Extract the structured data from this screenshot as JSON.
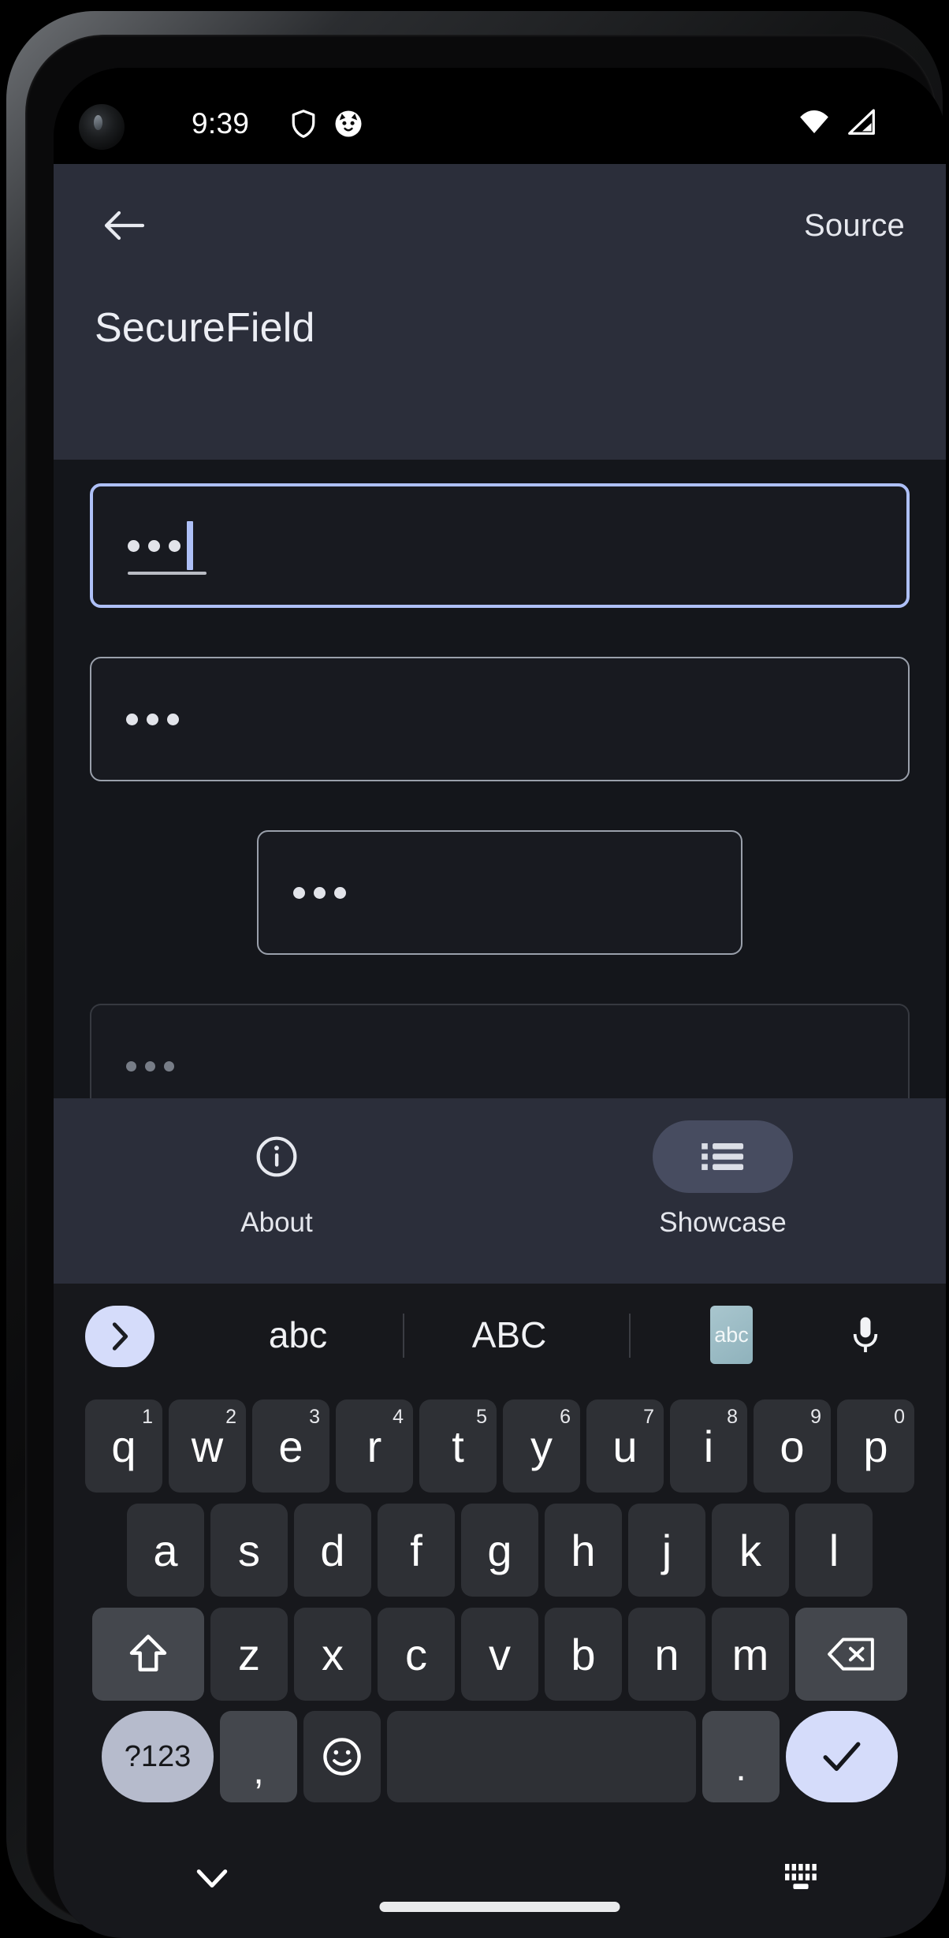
{
  "status_bar": {
    "time": "9:39",
    "left_icons": [
      "shield-icon",
      "cat-face-icon"
    ],
    "right_icons": [
      "wifi-icon",
      "cellular-signal-icon"
    ]
  },
  "app_bar": {
    "back_icon": "arrow-left-icon",
    "source_label": "Source",
    "title": "SecureField"
  },
  "fields": [
    {
      "id": "field-1",
      "value": "•••",
      "dots": 3,
      "state": "focused",
      "has_caret": true,
      "has_selection_handle": true,
      "width": "full",
      "border_color": "#aec0f7"
    },
    {
      "id": "field-2",
      "value": "•••",
      "dots": 3,
      "state": "enabled",
      "has_caret": false,
      "has_selection_handle": false,
      "width": "full",
      "border_color": "#9aa0ab"
    },
    {
      "id": "field-3",
      "value": "•••",
      "dots": 3,
      "state": "enabled",
      "has_caret": false,
      "has_selection_handle": false,
      "width": "narrow",
      "border_color": "#9aa0ab"
    },
    {
      "id": "field-4",
      "value": "•••",
      "dots": 3,
      "state": "disabled",
      "has_caret": false,
      "has_selection_handle": false,
      "width": "full",
      "border_color": "#535860"
    },
    {
      "id": "field-5",
      "value": "",
      "dots": 0,
      "state": "enabled",
      "has_caret": false,
      "has_selection_handle": false,
      "width": "full",
      "border_color": "#9aa0ab"
    }
  ],
  "bottom_nav": {
    "items": [
      {
        "label": "About",
        "icon": "info-circle-icon",
        "active": false
      },
      {
        "label": "Showcase",
        "icon": "list-icon",
        "active": true
      }
    ],
    "active_pill_color": "#474c60"
  },
  "keyboard": {
    "suggestion_bar": {
      "expand_icon": "chevron-right-icon",
      "suggestions": [
        "abc",
        "ABC"
      ],
      "clipboard_badge": "abc",
      "mic_icon": "microphone-icon"
    },
    "row1": [
      {
        "key": "q",
        "sup": "1"
      },
      {
        "key": "w",
        "sup": "2"
      },
      {
        "key": "e",
        "sup": "3"
      },
      {
        "key": "r",
        "sup": "4"
      },
      {
        "key": "t",
        "sup": "5"
      },
      {
        "key": "y",
        "sup": "6"
      },
      {
        "key": "u",
        "sup": "7"
      },
      {
        "key": "i",
        "sup": "8"
      },
      {
        "key": "o",
        "sup": "9"
      },
      {
        "key": "p",
        "sup": "0"
      }
    ],
    "row2": [
      "a",
      "s",
      "d",
      "f",
      "g",
      "h",
      "j",
      "k",
      "l"
    ],
    "row3": {
      "shift_icon": "shift-arrow-up-icon",
      "letters": [
        "z",
        "x",
        "c",
        "v",
        "b",
        "n",
        "m"
      ],
      "backspace_icon": "backspace-icon"
    },
    "row4": {
      "numeric_label": "?123",
      "comma_label": ",",
      "emoji_icon": "emoji-smiley-icon",
      "space_label": "",
      "period_label": ".",
      "enter_icon": "checkmark-icon"
    },
    "accent_key_color": "#d5dcfa",
    "key_color": "#2e3035",
    "modifier_key_color": "#44474d"
  },
  "gesture_bar": {
    "hide_keyboard_icon": "chevron-down-icon",
    "switch_keyboard_icon": "keyboard-switch-icon",
    "home_indicator": "home-pill"
  }
}
